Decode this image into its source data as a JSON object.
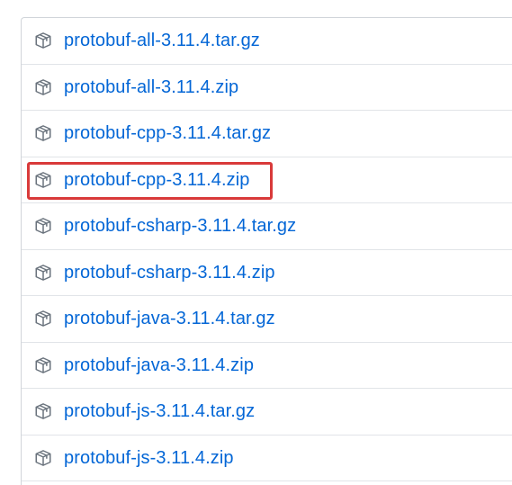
{
  "release_assets": {
    "items": [
      {
        "label": "protobuf-all-3.11.4.tar.gz",
        "icon": "package-icon"
      },
      {
        "label": "protobuf-all-3.11.4.zip",
        "icon": "package-icon"
      },
      {
        "label": "protobuf-cpp-3.11.4.tar.gz",
        "icon": "package-icon"
      },
      {
        "label": "protobuf-cpp-3.11.4.zip",
        "icon": "package-icon"
      },
      {
        "label": "protobuf-csharp-3.11.4.tar.gz",
        "icon": "package-icon"
      },
      {
        "label": "protobuf-csharp-3.11.4.zip",
        "icon": "package-icon"
      },
      {
        "label": "protobuf-java-3.11.4.tar.gz",
        "icon": "package-icon"
      },
      {
        "label": "protobuf-java-3.11.4.zip",
        "icon": "package-icon"
      },
      {
        "label": "protobuf-js-3.11.4.tar.gz",
        "icon": "package-icon"
      },
      {
        "label": "protobuf-js-3.11.4.zip",
        "icon": "package-icon"
      }
    ],
    "highlighted_item": "protobuf-cpp-3.11.4.zip"
  },
  "colors": {
    "link": "#0366d6",
    "icon": "#6a737d",
    "border": "#e1e4e8",
    "highlight": "#d93a3a"
  }
}
